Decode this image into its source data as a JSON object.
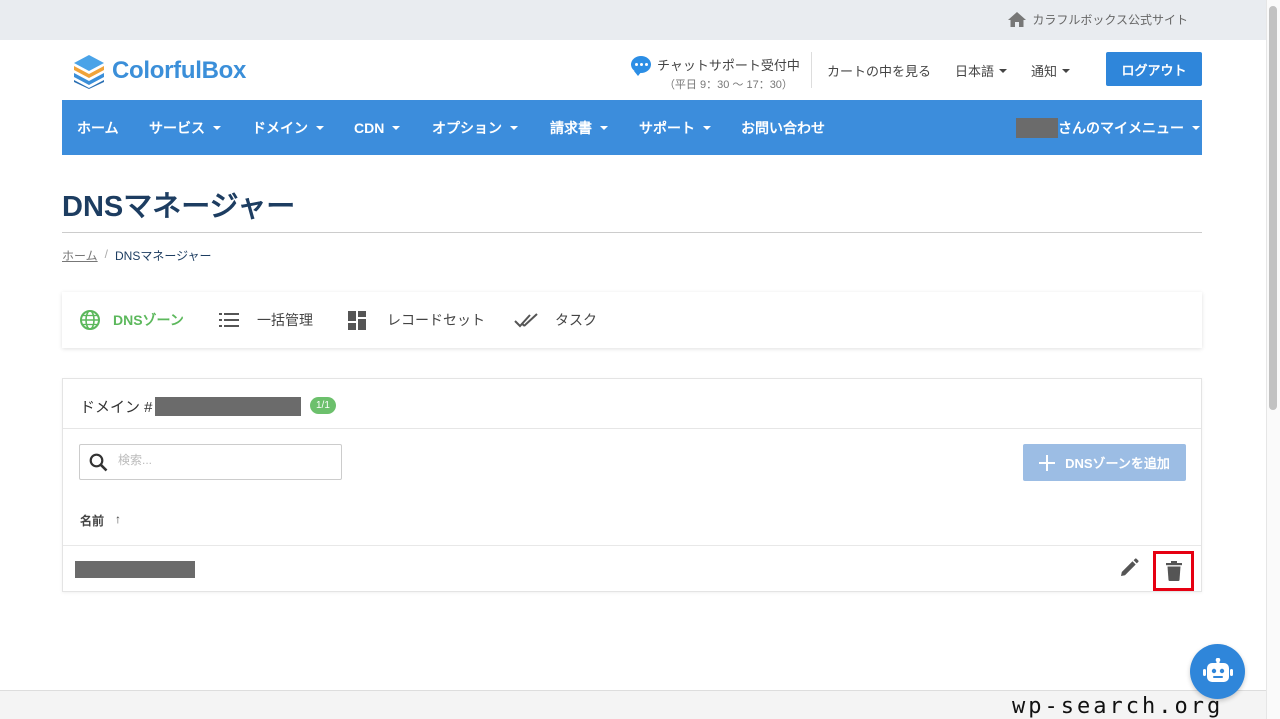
{
  "topbar": {
    "site_link": "カラフルボックス公式サイト"
  },
  "header": {
    "logo_text": "ColorfulBox",
    "chat_title": "チャットサポート受付中",
    "chat_hours": "（平日 9：30 〜 17：30）",
    "cart_label": "カートの中を見る",
    "language_label": "日本語",
    "notify_label": "通知",
    "logout_label": "ログアウト"
  },
  "nav": {
    "items": [
      {
        "label": "ホーム",
        "dropdown": false
      },
      {
        "label": "サービス",
        "dropdown": true
      },
      {
        "label": "ドメイン",
        "dropdown": true
      },
      {
        "label": "CDN",
        "dropdown": true
      },
      {
        "label": "オプション",
        "dropdown": true
      },
      {
        "label": "請求書",
        "dropdown": true
      },
      {
        "label": "サポート",
        "dropdown": true
      },
      {
        "label": "お問い合わせ",
        "dropdown": false
      }
    ],
    "user_menu_label": "さんのマイメニュー"
  },
  "page": {
    "title": "DNSマネージャー",
    "breadcrumb": {
      "home": "ホーム",
      "separator": "/",
      "current": "DNSマネージャー"
    }
  },
  "tabs": {
    "items": [
      {
        "label": "DNSゾーン",
        "icon": "globe-icon",
        "active": true
      },
      {
        "label": "一括管理",
        "icon": "list-icon",
        "active": false
      },
      {
        "label": "レコードセット",
        "icon": "dashboard-icon",
        "active": false
      },
      {
        "label": "タスク",
        "icon": "double-check-icon",
        "active": false
      }
    ]
  },
  "panel": {
    "title": "ドメイン #",
    "badge": "1/1",
    "search_placeholder": "検索...",
    "add_button_label": "DNSゾーンを追加",
    "column_name": "名前",
    "sort_arrow": "↑"
  },
  "watermark": "wp-search.org",
  "colors": {
    "primary": "#3c8ddc",
    "active_tab": "#5cb85c",
    "highlight": "#e60012",
    "badge": "#6cc06c"
  }
}
